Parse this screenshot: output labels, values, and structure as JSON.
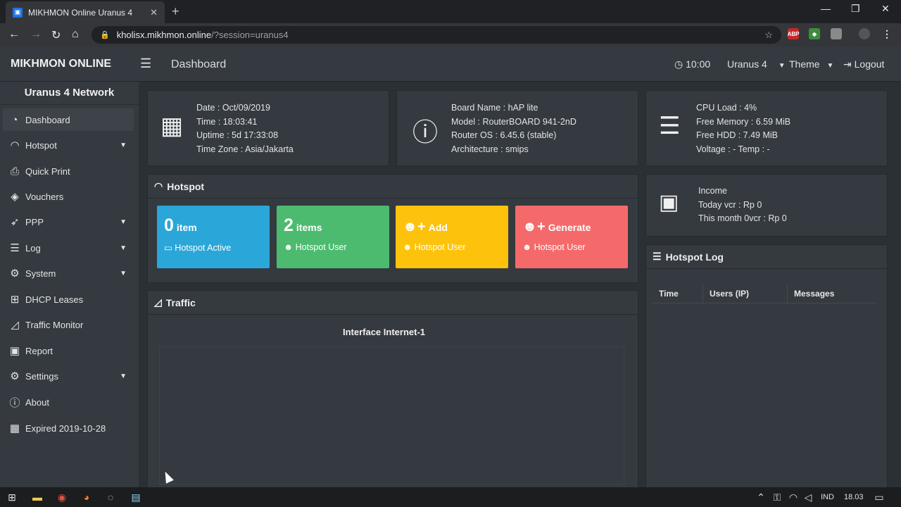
{
  "browser": {
    "tab_title": "MIKHMON Online Uranus 4",
    "url_host": "kholisx.mikhmon.online",
    "url_path": "/?session=uranus4",
    "ext_abp": "ABP"
  },
  "header": {
    "brand": "MIKHMON ONLINE",
    "page_title": "Dashboard",
    "clock": "10:00",
    "session": "Uranus 4",
    "theme": "Theme",
    "logout": "Logout"
  },
  "sidebar": {
    "title": "Uranus 4 Network",
    "items": [
      {
        "label": "Dashboard",
        "icon": "dashboard-icon"
      },
      {
        "label": "Hotspot",
        "icon": "wifi-icon"
      },
      {
        "label": "Quick Print",
        "icon": "printer-icon"
      },
      {
        "label": "Vouchers",
        "icon": "ticket-icon"
      },
      {
        "label": "PPP",
        "icon": "rocket-icon"
      },
      {
        "label": "Log",
        "icon": "list-icon"
      },
      {
        "label": "System",
        "icon": "gear-icon"
      },
      {
        "label": "DHCP Leases",
        "icon": "sitemap-icon"
      },
      {
        "label": "Traffic Monitor",
        "icon": "area-chart-icon"
      },
      {
        "label": "Report",
        "icon": "money-icon"
      },
      {
        "label": "Settings",
        "icon": "gear-icon"
      },
      {
        "label": "About",
        "icon": "info-icon"
      },
      {
        "label": "Expired 2019-10-28",
        "icon": "calendar-icon"
      }
    ]
  },
  "system_date": {
    "date": "Date : Oct/09/2019",
    "time": "Time : 18:03:41",
    "uptime": "Uptime : 5d 17:33:08",
    "timezone": "Time Zone : Asia/Jakarta"
  },
  "board": {
    "name": "Board Name : hAP lite",
    "model": "Model : RouterBOARD 941-2nD",
    "os": "Router OS : 6.45.6 (stable)",
    "arch": "Architecture : smips"
  },
  "resources": {
    "cpu": "CPU Load : 4%",
    "memory": "Free Memory : 6.59 MiB",
    "hdd": "Free HDD : 7.49 MiB",
    "voltage": "Voltage : - Temp : -"
  },
  "income": {
    "title": "Income",
    "today": "Today vcr : Rp 0",
    "month": "This month 0vcr : Rp 0"
  },
  "hotspot": {
    "title": "Hotspot",
    "tiles": [
      {
        "big": "0",
        "small": "item",
        "sub": "Hotspot Active",
        "color": "#2aa7d8"
      },
      {
        "big": "2",
        "small": "items",
        "sub": "Hotspot User",
        "color": "#4cbb6f"
      },
      {
        "big": "",
        "small": "Add",
        "sub": "Hotspot User",
        "color": "#fdc20b"
      },
      {
        "big": "",
        "small": "Generate",
        "sub": "Hotspot User",
        "color": "#f46a6a"
      }
    ]
  },
  "traffic": {
    "title": "Traffic",
    "chart_title": "Interface Internet-1"
  },
  "hotspot_log": {
    "title": "Hotspot Log",
    "columns": [
      "Time",
      "Users (IP)",
      "Messages"
    ]
  },
  "taskbar": {
    "lang": "IND",
    "time": "18.03"
  }
}
